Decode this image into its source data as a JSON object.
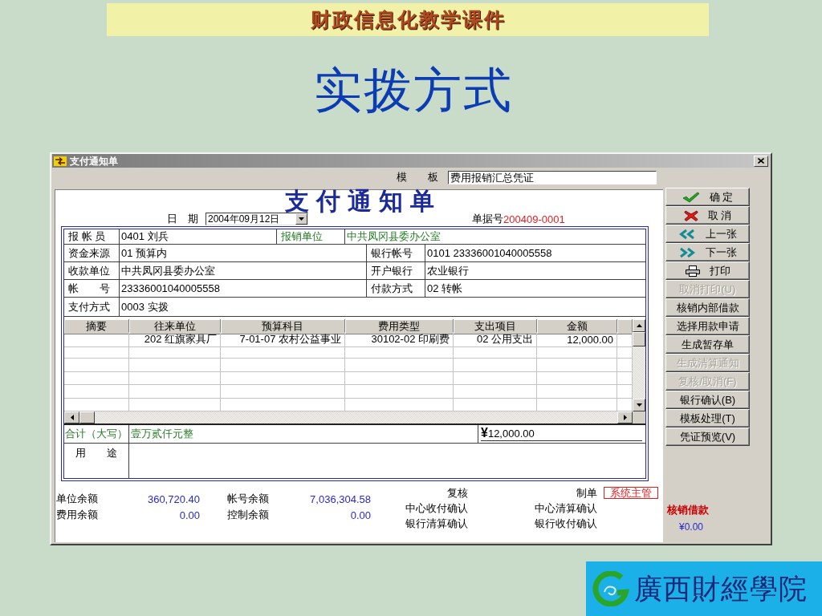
{
  "slide": {
    "banner": "财政信息化教学课件",
    "title": "实拨方式",
    "logo_text": "廣西財經學院"
  },
  "window": {
    "title": "支付通知单"
  },
  "template": {
    "label": "模　　板",
    "value": "费用报销汇总凭证"
  },
  "voucher": {
    "heading": "支付通知单",
    "date_label": "日　期",
    "date_value": "2004年09月12日",
    "number_label": "单据号",
    "number_value": "200409-0001"
  },
  "form_rows": [
    {
      "kind": "short",
      "cells": [
        {
          "label": "报 帐 员",
          "value": "0401 刘兵",
          "highlighted": false
        },
        {
          "label": "报销单位",
          "value": "中共凤冈县委办公室",
          "highlighted": true
        }
      ]
    },
    {
      "kind": "long",
      "cells": [
        {
          "label": "资金来源",
          "value": "01 预算内",
          "highlighted": false
        },
        {
          "label": "银行帐号",
          "value": "0101 23336001040005558",
          "highlighted": false
        }
      ]
    },
    {
      "kind": "long",
      "cells": [
        {
          "label": "收款单位",
          "value": "中共凤冈县委办公室",
          "highlighted": false
        },
        {
          "label": "开户银行",
          "value": "农业银行",
          "highlighted": false
        }
      ]
    },
    {
      "kind": "long",
      "cells": [
        {
          "label": "帐　　号",
          "value": "23336001040005558",
          "highlighted": false
        },
        {
          "label": "付款方式",
          "value": "02 转帐",
          "highlighted": false
        }
      ]
    },
    {
      "kind": "single",
      "cells": [
        {
          "label": "支付方式",
          "value": "0003 实拨",
          "highlighted": false
        }
      ]
    }
  ],
  "table": {
    "columns": [
      "摘要",
      "往来单位",
      "预算科目",
      "费用类型",
      "支出项目",
      "金额"
    ],
    "rows": [
      {
        "counterparty": "202 红旗家具厂",
        "budget_item": "7-01-07 农村公益事业",
        "expense_type": "30102-02 印刷费",
        "expenditure_item": "02 公用支出",
        "amount": "12,000.00"
      }
    ]
  },
  "total": {
    "label": "合计（大写）",
    "words": "壹万贰仟元整",
    "amount": "**¥**12,000.00"
  },
  "purpose": {
    "label": "用　　途"
  },
  "balances": [
    {
      "label": "单位余额",
      "value": "360,720.40"
    },
    {
      "label": "帐号余额",
      "value": "7,036,304.58"
    },
    {
      "label": "费用余额",
      "value": "0.00"
    },
    {
      "label": "控制余额",
      "value": "0.00"
    }
  ],
  "signatures": [
    {
      "label": "复核"
    },
    {
      "label": "制单",
      "value": "系统主管"
    },
    {
      "label": "中心收付确认"
    },
    {
      "label": "中心清算确认"
    },
    {
      "label": "银行清算确认"
    },
    {
      "label": "银行收付确认"
    }
  ],
  "buttons": [
    {
      "label": "确 定",
      "kind": "confirm",
      "disabled": false
    },
    {
      "label": "取 消",
      "kind": "cancel",
      "disabled": false
    },
    {
      "label": "上一张",
      "kind": "previous",
      "disabled": false
    },
    {
      "label": "下一张",
      "kind": "next",
      "disabled": false
    },
    {
      "label": "打印",
      "kind": "print",
      "disabled": false
    },
    {
      "label": "取消打印(U)",
      "kind": "text",
      "disabled": true
    },
    {
      "label": "核销内部借款",
      "kind": "text",
      "disabled": false
    },
    {
      "label": "选择用款申请",
      "kind": "text",
      "disabled": false
    },
    {
      "label": "生成暂存单",
      "kind": "text",
      "disabled": false
    },
    {
      "label": "生成清算通知",
      "kind": "text",
      "disabled": true
    },
    {
      "label": "复核/取消(F)",
      "kind": "text",
      "disabled": true
    },
    {
      "label": "银行确认(B)",
      "kind": "text",
      "disabled": false
    },
    {
      "label": "模板处理(T)",
      "kind": "text",
      "disabled": false
    },
    {
      "label": "凭证预览(V)",
      "kind": "text",
      "disabled": false
    }
  ],
  "write_off": {
    "label": "核销借款",
    "amount": "¥0.00"
  }
}
